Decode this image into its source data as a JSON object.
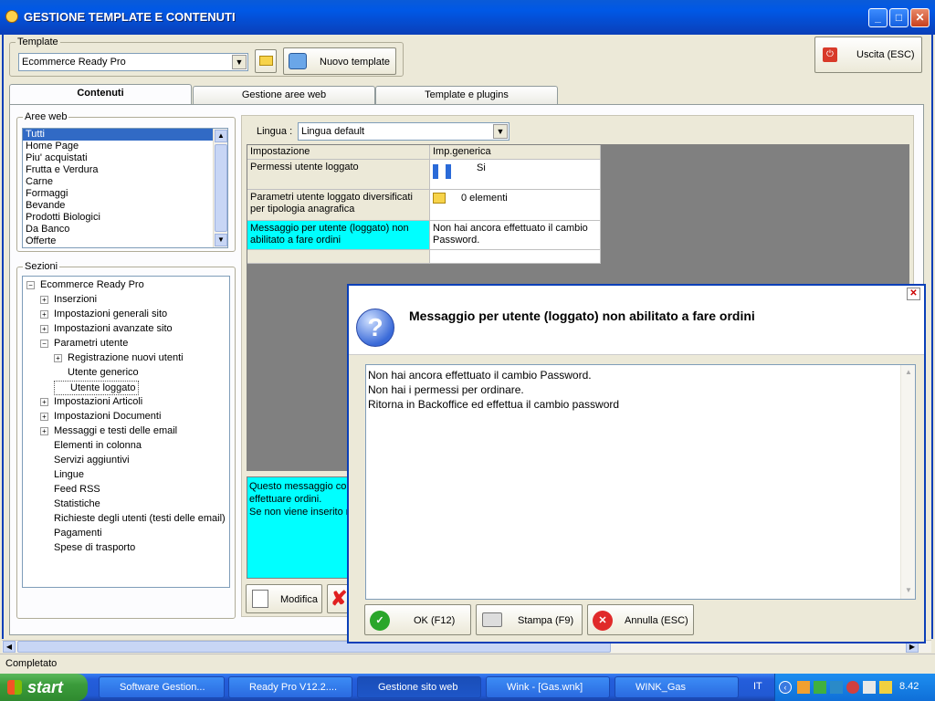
{
  "window": {
    "title": "GESTIONE TEMPLATE E CONTENUTI",
    "minimize": "_",
    "maximize": "□",
    "close": "✕"
  },
  "template": {
    "legend": "Template",
    "selected": "Ecommerce Ready Pro",
    "new_button": "Nuovo template"
  },
  "exit_button": "Uscita (ESC)",
  "tabs": [
    {
      "label": "Contenuti"
    },
    {
      "label": "Gestione aree web"
    },
    {
      "label": "Template e plugins"
    }
  ],
  "aree_web": {
    "legend": "Aree web",
    "items": [
      "Tutti",
      "Home Page",
      "Piu' acquistati",
      "Frutta e Verdura",
      "Carne",
      "Formaggi",
      "Bevande",
      "Prodotti Biologici",
      "Da Banco",
      "Offerte"
    ]
  },
  "sezioni": {
    "legend": "Sezioni",
    "root": "Ecommerce Ready Pro",
    "items": [
      {
        "label": "Inserzioni",
        "toggle": "+"
      },
      {
        "label": "Impostazioni generali sito",
        "toggle": "+"
      },
      {
        "label": "Impostazioni avanzate sito",
        "toggle": "+"
      },
      {
        "label": "Parametri utente",
        "toggle": "−"
      },
      {
        "label": "Registrazione nuovi utenti",
        "toggle": "+"
      },
      {
        "label": "Utente generico",
        "toggle": ""
      },
      {
        "label": "Utente loggato",
        "toggle": ""
      },
      {
        "label": "Impostazioni Articoli",
        "toggle": "+"
      },
      {
        "label": "Impostazioni Documenti",
        "toggle": "+"
      },
      {
        "label": "Messaggi e testi delle email",
        "toggle": "+"
      },
      {
        "label": "Elementi in colonna",
        "toggle": ""
      },
      {
        "label": "Servizi aggiuntivi",
        "toggle": ""
      },
      {
        "label": "Lingue",
        "toggle": ""
      },
      {
        "label": "Feed RSS",
        "toggle": ""
      },
      {
        "label": "Statistiche",
        "toggle": ""
      },
      {
        "label": "Richieste degli utenti (testi delle email)",
        "toggle": ""
      },
      {
        "label": "Pagamenti",
        "toggle": ""
      },
      {
        "label": "Spese di trasporto",
        "toggle": ""
      }
    ]
  },
  "lingua": {
    "label": "Lingua :",
    "selected": "Lingua default"
  },
  "grid": {
    "headers": [
      "Impostazione",
      "Imp.generica"
    ],
    "rows": [
      {
        "key": "Permessi utente loggato",
        "value": "Si"
      },
      {
        "key": "Parametri utente loggato diversificati per tipologia anagrafica",
        "value": "0 elementi"
      },
      {
        "key": "Messaggio per utente (loggato) non abilitato a fare ordini",
        "value": "Non hai ancora effettuato il cambio Password."
      }
    ]
  },
  "description": {
    "lines": [
      "Questo messaggio con",
      "effettuare ordini.",
      "Se non viene inserito n"
    ]
  },
  "modifica_button": "Modifica",
  "dialog": {
    "title": "Messaggio per utente (loggato) non abilitato a fare ordini",
    "text_lines": [
      "Non hai ancora effettuato il cambio Password.",
      "Non hai i permessi per ordinare.",
      "Ritorna in Backoffice ed effettua il cambio password"
    ],
    "ok": "OK (F12)",
    "print": "Stampa (F9)",
    "cancel": "Annulla (ESC)"
  },
  "status": "Completato",
  "taskbar": {
    "start": "start",
    "tasks": [
      "Software Gestion...",
      "Ready Pro V12.2....",
      "Gestione sito web",
      "Wink - [Gas.wnk]",
      "WINK_Gas"
    ],
    "lang": "IT",
    "clock": "8.42"
  }
}
